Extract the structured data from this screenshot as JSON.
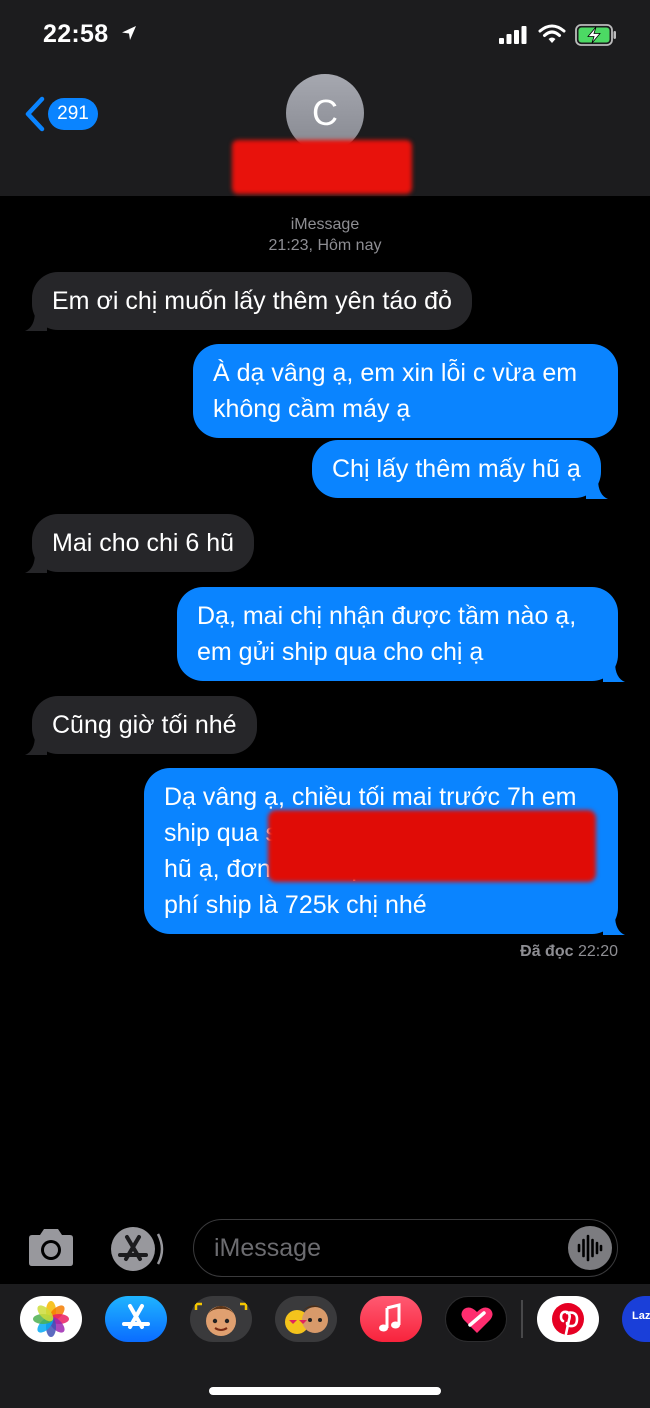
{
  "status_bar": {
    "time": "22:58",
    "icons": [
      "location-arrow-icon",
      "cellular-signal-icon",
      "wifi-icon",
      "battery-charging-icon"
    ]
  },
  "header": {
    "back_count": "291",
    "avatar_initial": "C",
    "contact_name": "[redacted]"
  },
  "thread": {
    "service": "iMessage",
    "timestamp": "21:23, Hôm nay",
    "messages": [
      {
        "side": "incoming",
        "text": "Em ơi chị muốn lấy thêm yên táo đỏ"
      },
      {
        "side": "outgoing",
        "text": "À dạ vâng ạ, em xin lỗi c vừa em không cầm máy ạ"
      },
      {
        "side": "outgoing",
        "text": "Chị lấy thêm mấy hũ ạ"
      },
      {
        "side": "incoming",
        "text": "Mai cho chi 6 hũ"
      },
      {
        "side": "outgoing",
        "text": "Dạ, mai chị nhận được tầm nào ạ, em gửi ship qua cho chị ạ"
      },
      {
        "side": "incoming",
        "text": "Cũng giờ tối nhé"
      },
      {
        "side": "outgoing",
        "line1": "Dạ vâng ạ, chiều tối mai trước 7h em",
        "line2": "ship qua s",
        "line3": "hũ ạ, đơn của chị 6 hũ là 700k + 25k",
        "line4": "phí ship là 725k chị nhé"
      }
    ],
    "read_label": "Đã đọc",
    "read_time": "22:20"
  },
  "input_bar": {
    "placeholder": "iMessage"
  },
  "app_drawer": {
    "apps": [
      "photos-icon",
      "app-store-icon",
      "memoji-icon",
      "animoji-stickers-icon",
      "music-icon",
      "digital-touch-icon",
      "pinterest-icon",
      "lazada-icon"
    ],
    "lazada_partial_label": "Laz"
  },
  "colors": {
    "outgoing_bubble": "#0a84ff",
    "incoming_bubble": "#262629",
    "header_bg": "#1c1c1e",
    "redaction": "#e00c06"
  }
}
